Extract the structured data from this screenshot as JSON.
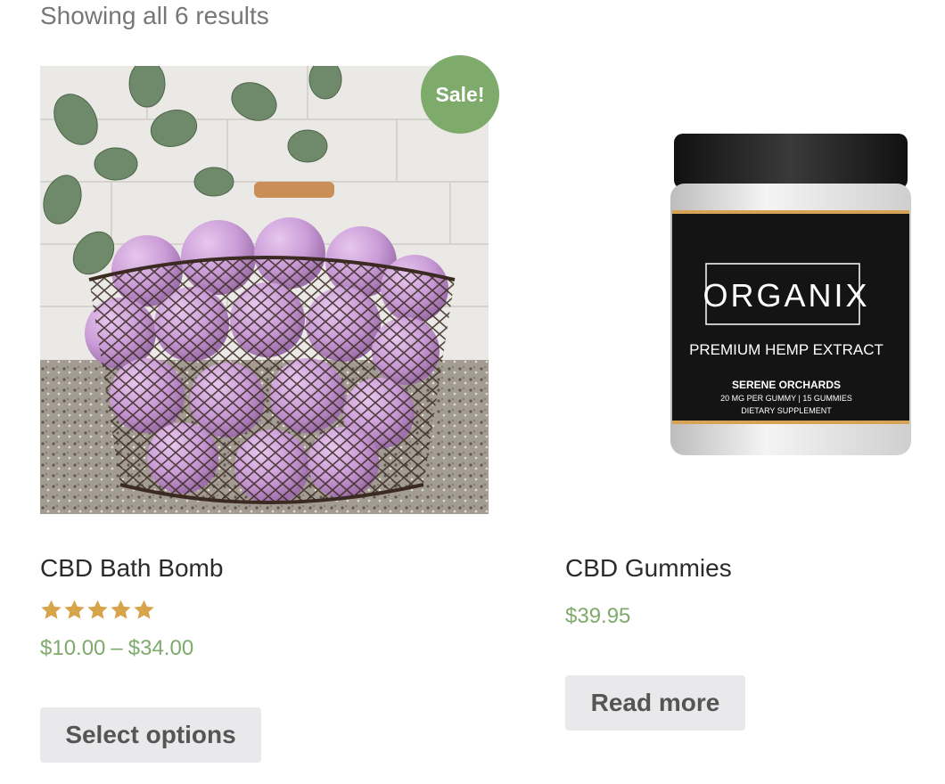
{
  "result_count": "Showing all 6 results",
  "products": [
    {
      "badge": "Sale!",
      "title": "CBD Bath Bomb",
      "rating_stars": 5,
      "price_min": "$10.00",
      "price_sep": "–",
      "price_max": "$34.00",
      "button": "Select options"
    },
    {
      "title": "CBD Gummies",
      "price": "$39.95",
      "button": "Read more",
      "label": {
        "brand": "ORGANIX",
        "line1": "PREMIUM HEMP EXTRACT",
        "line2": "SERENE ORCHARDS",
        "line3": "20 MG PER GUMMY | 15 GUMMIES",
        "line4": "DIETARY SUPPLEMENT"
      }
    }
  ],
  "colors": {
    "accent": "#7eaa6c",
    "star": "#d7a44a",
    "button_bg": "#e9e8ea",
    "button_text": "#555555",
    "title_text": "#2b2b2b",
    "muted_text": "#777777"
  }
}
